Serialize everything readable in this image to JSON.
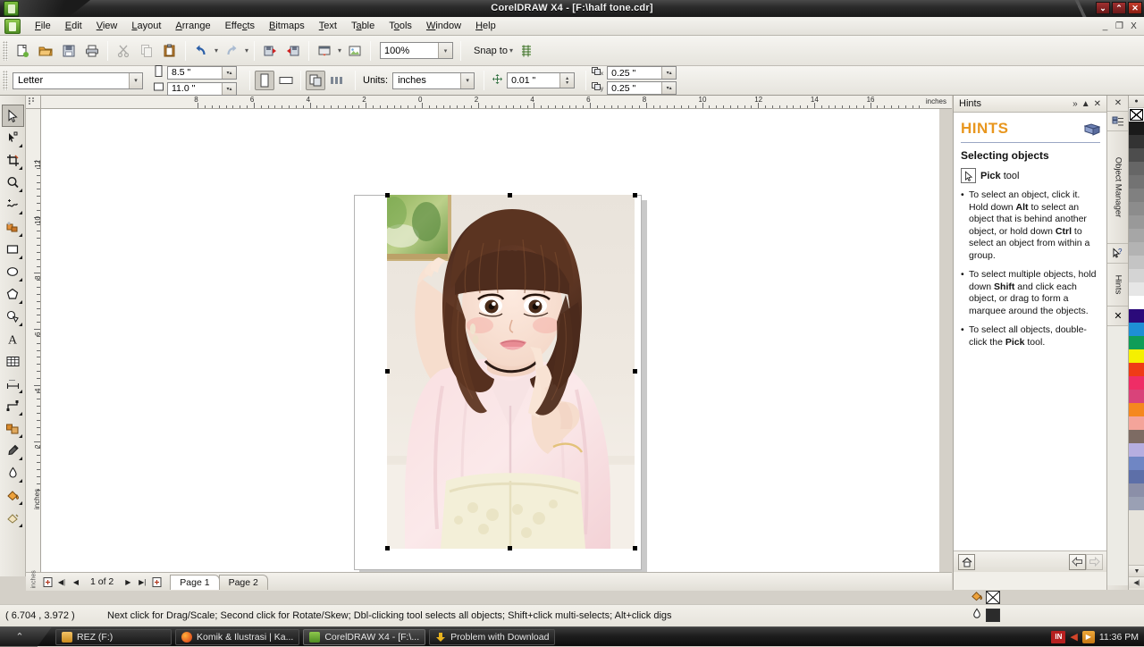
{
  "window": {
    "title": "CorelDRAW X4 - [F:\\half tone.cdr]",
    "minimize": "⌄",
    "maximize": "⌃",
    "close": "✕"
  },
  "doc_window": {
    "minimize": "_",
    "restore": "❐",
    "close": "X"
  },
  "menu": {
    "items": [
      {
        "label": "File",
        "accel": "F"
      },
      {
        "label": "Edit",
        "accel": "E"
      },
      {
        "label": "View",
        "accel": "V"
      },
      {
        "label": "Layout",
        "accel": "L"
      },
      {
        "label": "Arrange",
        "accel": "A"
      },
      {
        "label": "Effects",
        "accel": "c"
      },
      {
        "label": "Bitmaps",
        "accel": "B"
      },
      {
        "label": "Text",
        "accel": "T"
      },
      {
        "label": "Table",
        "accel": "a"
      },
      {
        "label": "Tools",
        "accel": "o"
      },
      {
        "label": "Window",
        "accel": "W"
      },
      {
        "label": "Help",
        "accel": "H"
      }
    ]
  },
  "standard_toolbar": {
    "buttons": [
      {
        "name": "new-document",
        "icon": "new-doc-icon",
        "disabled": false
      },
      {
        "name": "open-document",
        "icon": "open-folder-icon",
        "disabled": false
      },
      {
        "name": "save-document",
        "icon": "floppy-save-icon",
        "disabled": false
      },
      {
        "name": "print",
        "icon": "printer-icon",
        "disabled": false
      },
      {
        "name": "cut",
        "icon": "scissors-icon",
        "disabled": true
      },
      {
        "name": "copy",
        "icon": "copy-icon",
        "disabled": true
      },
      {
        "name": "paste",
        "icon": "clipboard-paste-icon",
        "disabled": false
      },
      {
        "name": "undo",
        "icon": "undo-arrow-icon",
        "disabled": false
      },
      {
        "name": "redo",
        "icon": "redo-arrow-icon",
        "disabled": true
      },
      {
        "name": "import",
        "icon": "import-icon",
        "disabled": false
      },
      {
        "name": "export",
        "icon": "export-icon",
        "disabled": false
      },
      {
        "name": "launch-app",
        "icon": "application-launcher-icon",
        "disabled": false
      },
      {
        "name": "corel-online",
        "icon": "corel-connect-icon",
        "disabled": false
      }
    ],
    "zoom_level": "100%",
    "snap_to_label": "Snap to",
    "options_icon": "options-icon"
  },
  "property_bar": {
    "paper_type": "Letter",
    "page_width": "8.5 \"",
    "page_height": "11.0 \"",
    "orientation_portrait": "portrait-icon",
    "orientation_landscape": "landscape-icon",
    "all_pages_icon": "all-pages-icon",
    "current_page_icon": "current-page-icon",
    "units_label": "Units:",
    "units_value": "inches",
    "nudge_icon": "nudge-offset-icon",
    "nudge_value": "0.01 \"",
    "duplicate_x_icon": "duplicate-distance-x-icon",
    "duplicate_x": "0.25 \"",
    "duplicate_y_icon": "duplicate-distance-y-icon",
    "duplicate_y": "0.25 \""
  },
  "toolbox": {
    "tools": [
      {
        "name": "pick-tool",
        "icon": "arrow-cursor-icon",
        "selected": true,
        "flyout": false
      },
      {
        "name": "shape-tool",
        "icon": "node-edit-icon",
        "selected": false,
        "flyout": true
      },
      {
        "name": "crop-tool",
        "icon": "crop-icon",
        "selected": false,
        "flyout": true
      },
      {
        "name": "zoom-tool",
        "icon": "magnifier-icon",
        "selected": false,
        "flyout": true
      },
      {
        "name": "freehand-tool",
        "icon": "freehand-curve-icon",
        "selected": false,
        "flyout": true
      },
      {
        "name": "smart-fill-tool",
        "icon": "smart-fill-icon",
        "selected": false,
        "flyout": true
      },
      {
        "name": "rectangle-tool",
        "icon": "rectangle-icon",
        "selected": false,
        "flyout": true
      },
      {
        "name": "ellipse-tool",
        "icon": "ellipse-icon",
        "selected": false,
        "flyout": true
      },
      {
        "name": "polygon-tool",
        "icon": "polygon-icon",
        "selected": false,
        "flyout": true
      },
      {
        "name": "basic-shapes-tool",
        "icon": "basic-shapes-icon",
        "selected": false,
        "flyout": true
      },
      {
        "name": "text-tool",
        "icon": "text-a-icon",
        "selected": false,
        "flyout": false
      },
      {
        "name": "table-tool",
        "icon": "table-grid-icon",
        "selected": false,
        "flyout": false
      },
      {
        "name": "dimension-tool",
        "icon": "dimension-line-icon",
        "selected": false,
        "flyout": true
      },
      {
        "name": "connector-tool",
        "icon": "connector-line-icon",
        "selected": false,
        "flyout": true
      },
      {
        "name": "blend-tool",
        "icon": "blend-effect-icon",
        "selected": false,
        "flyout": true
      },
      {
        "name": "eyedropper-tool",
        "icon": "eyedropper-icon",
        "selected": false,
        "flyout": true
      },
      {
        "name": "outline-tool",
        "icon": "outline-pen-icon",
        "selected": false,
        "flyout": true
      },
      {
        "name": "fill-tool",
        "icon": "fill-bucket-icon",
        "selected": false,
        "flyout": true
      },
      {
        "name": "interactive-fill",
        "icon": "interactive-fill-icon",
        "selected": false,
        "flyout": true
      }
    ]
  },
  "rulers": {
    "unit_label": "inches",
    "h_labels": [
      "8",
      "6",
      "4",
      "2",
      "0",
      "2",
      "4",
      "6",
      "8",
      "10",
      "12",
      "14",
      "16"
    ],
    "v_labels": [
      "12",
      "10",
      "8",
      "6",
      "4",
      "2"
    ],
    "v_unit_label": "inches"
  },
  "docker": {
    "title": "Hints",
    "collapse_icon": "double-chevron-right-icon",
    "minimize_icon": "triangle-up-icon",
    "close_icon": "close-x-icon",
    "heading": "HINTS",
    "book_icon": "book-icon",
    "subheading": "Selecting objects",
    "tool_icon": "pick-tool-icon",
    "tool_name_bold": "Pick",
    "tool_name_rest": " tool",
    "bullets": [
      "To select an object, click it. Hold down <b>Alt</b> to select an object that is behind another object, or hold down <b>Ctrl</b> to select an object from within a group.",
      "To select multiple objects, hold down <b>Shift</b> and click each object, or drag to form a marquee around the objects.",
      "To select all objects, double-click the <b>Pick</b> tool."
    ],
    "footer": {
      "home_icon": "home-icon",
      "back_icon": "back-arrow-icon",
      "forward_icon": "forward-arrow-icon"
    }
  },
  "side_tabs": [
    {
      "label": "Object Manager",
      "icon": "object-manager-icon",
      "name": "sidetab-object-manager"
    },
    {
      "label": "Hints",
      "icon": "hints-cursor-question-icon",
      "name": "sidetab-hints"
    }
  ],
  "palette": {
    "top_icon": "palette-scroll-up-icon",
    "bottom_icon": "palette-scroll-down-icon",
    "expand_icon": "palette-expand-icon",
    "colors": [
      "#ffffff-none",
      "#1a1a1a",
      "#333333",
      "#4d4d4d",
      "#666666",
      "#737373",
      "#808080",
      "#8c8c8c",
      "#999999",
      "#a6a6a6",
      "#b3b3b3",
      "#c4c4c4",
      "#d4d4d4",
      "#e6e6e6",
      "#ffffff",
      "#2b0a7a",
      "#1e8fd5",
      "#0f9d58",
      "#f5f000",
      "#ef3b16",
      "#ef2d66",
      "#d9437a",
      "#f5881f",
      "#f4a49a",
      "#7d6b63",
      "#b6aee0",
      "#6f86c4",
      "#5d6fa8",
      "#8b8fa8",
      "#9aa0b4"
    ]
  },
  "fill_indicator": {
    "fill_icon": "fill-bucket-icon",
    "fill_value": "none",
    "outline_icon": "outline-pen-icon",
    "outline_color": "#2b2b2b"
  },
  "page_bar": {
    "add_page_start_icon": "add-page-icon",
    "first_page_icon": "first-page-icon",
    "prev_page_icon": "prev-page-icon",
    "page_counter": "1 of 2",
    "next_page_icon": "next-page-icon",
    "last_page_icon": "last-page-icon",
    "add_page_end_icon": "add-page-icon",
    "tabs": [
      {
        "label": "Page 1",
        "selected": true
      },
      {
        "label": "Page 2",
        "selected": false
      }
    ]
  },
  "status_bar": {
    "coordinates": "( 6.704 , 3.972 )",
    "message": "Next click for Drag/Scale; Second click for Rotate/Skew; Dbl-clicking tool selects all objects; Shift+click multi-selects; Alt+click digs"
  },
  "taskbar": {
    "start_icon": "start-chevron-icon",
    "items": [
      {
        "label": "REZ (F:)",
        "icon": "folder-icon",
        "color": "#d8a13a",
        "active": false
      },
      {
        "label": "Komik & Ilustrasi | Ka...",
        "icon": "firefox-icon",
        "color": "#e25822",
        "active": false
      },
      {
        "label": "CorelDRAW X4 - [F:\\...",
        "icon": "coreldraw-icon",
        "color": "#6cb33f",
        "active": true
      },
      {
        "label": "Problem with Download",
        "icon": "download-icon",
        "color": "#e8b21e",
        "active": false
      }
    ],
    "tray": {
      "language": "IN",
      "media_icon": "media-player-icon",
      "clock": "11:36 PM"
    }
  }
}
